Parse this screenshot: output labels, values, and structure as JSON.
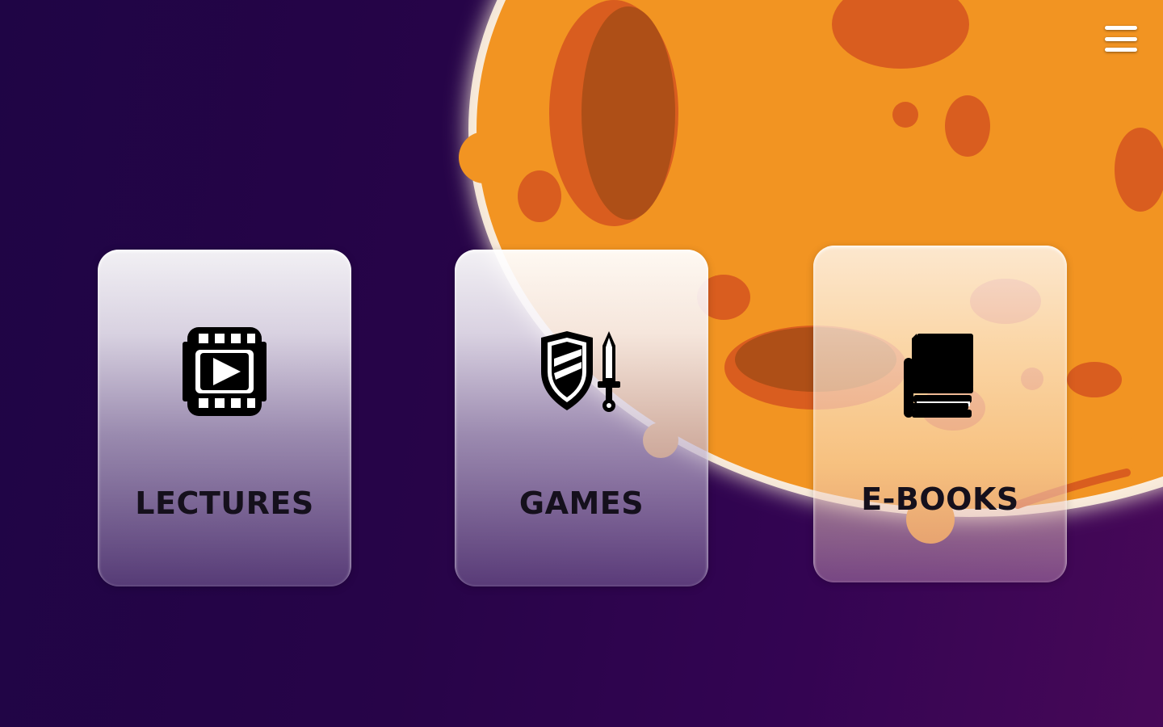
{
  "app": {
    "menu_icon": "hamburger-menu-icon"
  },
  "cards": [
    {
      "label": "LECTURES",
      "icon": "film-play-icon"
    },
    {
      "label": "GAMES",
      "icon": "shield-sword-icon"
    },
    {
      "label": "E-BOOKS",
      "icon": "book-icon"
    }
  ],
  "colors": {
    "background_left": "#1f0545",
    "background_right": "#470858",
    "planet": "#f29422",
    "crater": "#d95d1f",
    "crater_shadow": "#ae4f17",
    "text": "#15101c"
  }
}
